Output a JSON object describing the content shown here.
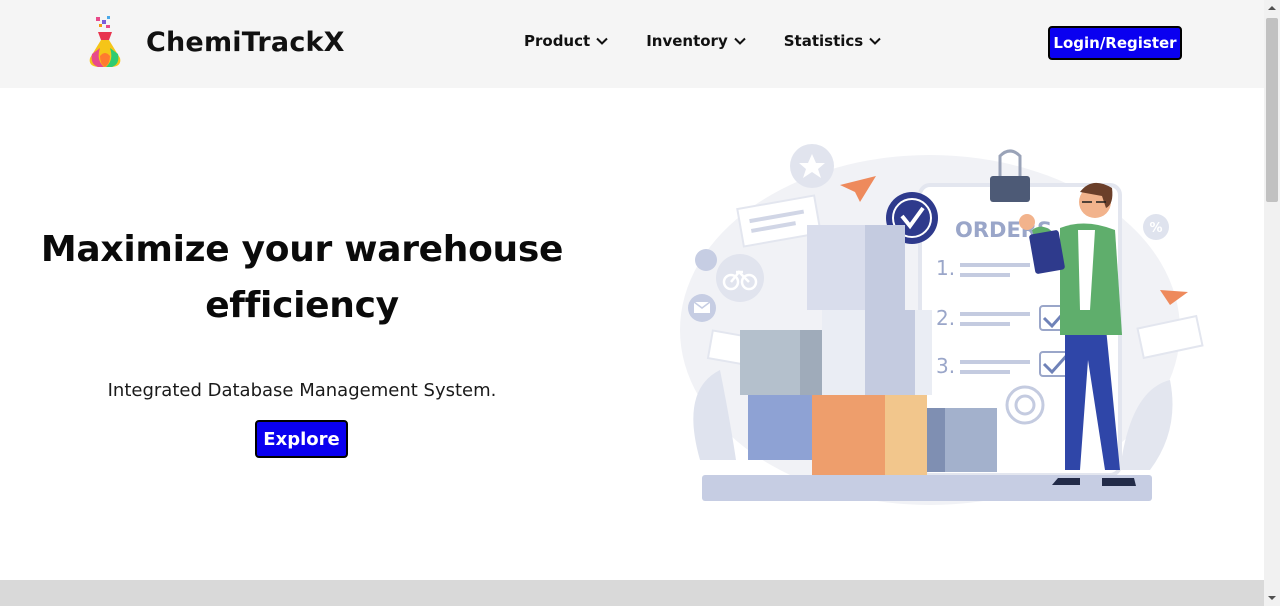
{
  "brand": {
    "name": "ChemiTrackX",
    "logo_icon": "flask-logo-icon"
  },
  "nav": {
    "items": [
      {
        "label": "Product",
        "icon": "chevron-down-icon"
      },
      {
        "label": "Inventory",
        "icon": "chevron-down-icon"
      },
      {
        "label": "Statistics",
        "icon": "chevron-down-icon"
      }
    ],
    "login_label": "Login/Register"
  },
  "hero": {
    "title_line1": "Maximize your warehouse",
    "title_line2": "efficiency",
    "subtitle": "Integrated Database Management System.",
    "cta_label": "Explore"
  },
  "illustration": {
    "clipboard_title": "ORDERS",
    "list_numbers": [
      "1.",
      "2.",
      "3."
    ]
  },
  "colors": {
    "primary_button": "#0a00f0",
    "header_bg": "#f5f5f5",
    "footer_band": "#d9d9d9"
  }
}
